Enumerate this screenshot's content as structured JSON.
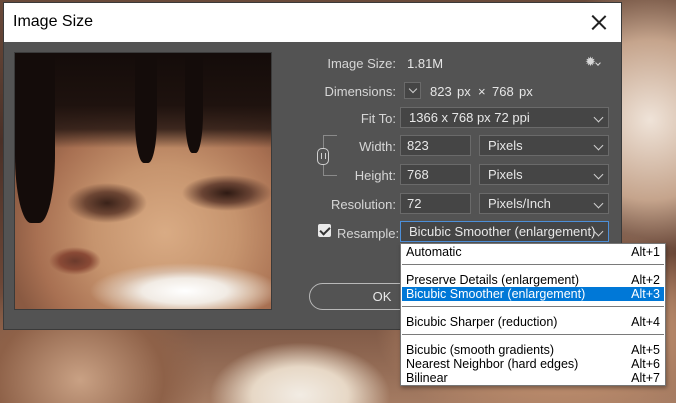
{
  "dialog": {
    "title": "Image Size"
  },
  "image_size": {
    "label": "Image Size:",
    "value": "1.81M"
  },
  "dimensions": {
    "label": "Dimensions:",
    "width": "823",
    "unit": "px",
    "x": "×",
    "height": "768"
  },
  "fit_to": {
    "label": "Fit To:",
    "value": "1366 x 768 px 72 ppi"
  },
  "width": {
    "label": "Width:",
    "value": "823",
    "unit": "Pixels"
  },
  "height": {
    "label": "Height:",
    "value": "768",
    "unit": "Pixels"
  },
  "resolution": {
    "label": "Resolution:",
    "value": "72",
    "unit": "Pixels/Inch"
  },
  "resample": {
    "label": "Resample:",
    "checked": true,
    "value": "Bicubic Smoother (enlargement)"
  },
  "buttons": {
    "ok": "OK"
  },
  "menu": {
    "items": [
      {
        "label": "Automatic",
        "shortcut": "Alt+1",
        "selected": false
      },
      {
        "label": "Preserve Details (enlargement)",
        "shortcut": "Alt+2",
        "selected": false
      },
      {
        "label": "Bicubic Smoother (enlargement)",
        "shortcut": "Alt+3",
        "selected": true
      },
      {
        "label": "Bicubic Sharper (reduction)",
        "shortcut": "Alt+4",
        "selected": false
      },
      {
        "label": "Bicubic (smooth gradients)",
        "shortcut": "Alt+5",
        "selected": false
      },
      {
        "label": "Nearest Neighbor (hard edges)",
        "shortcut": "Alt+6",
        "selected": false
      },
      {
        "label": "Bilinear",
        "shortcut": "Alt+7",
        "selected": false
      }
    ]
  },
  "icons": {
    "close": "close-icon",
    "settings": "gear-icon",
    "link": "chain-link-icon",
    "chevron": "chevron-down-icon"
  },
  "colors": {
    "dialog_bg": "#535353",
    "selection": "#0078d7"
  }
}
